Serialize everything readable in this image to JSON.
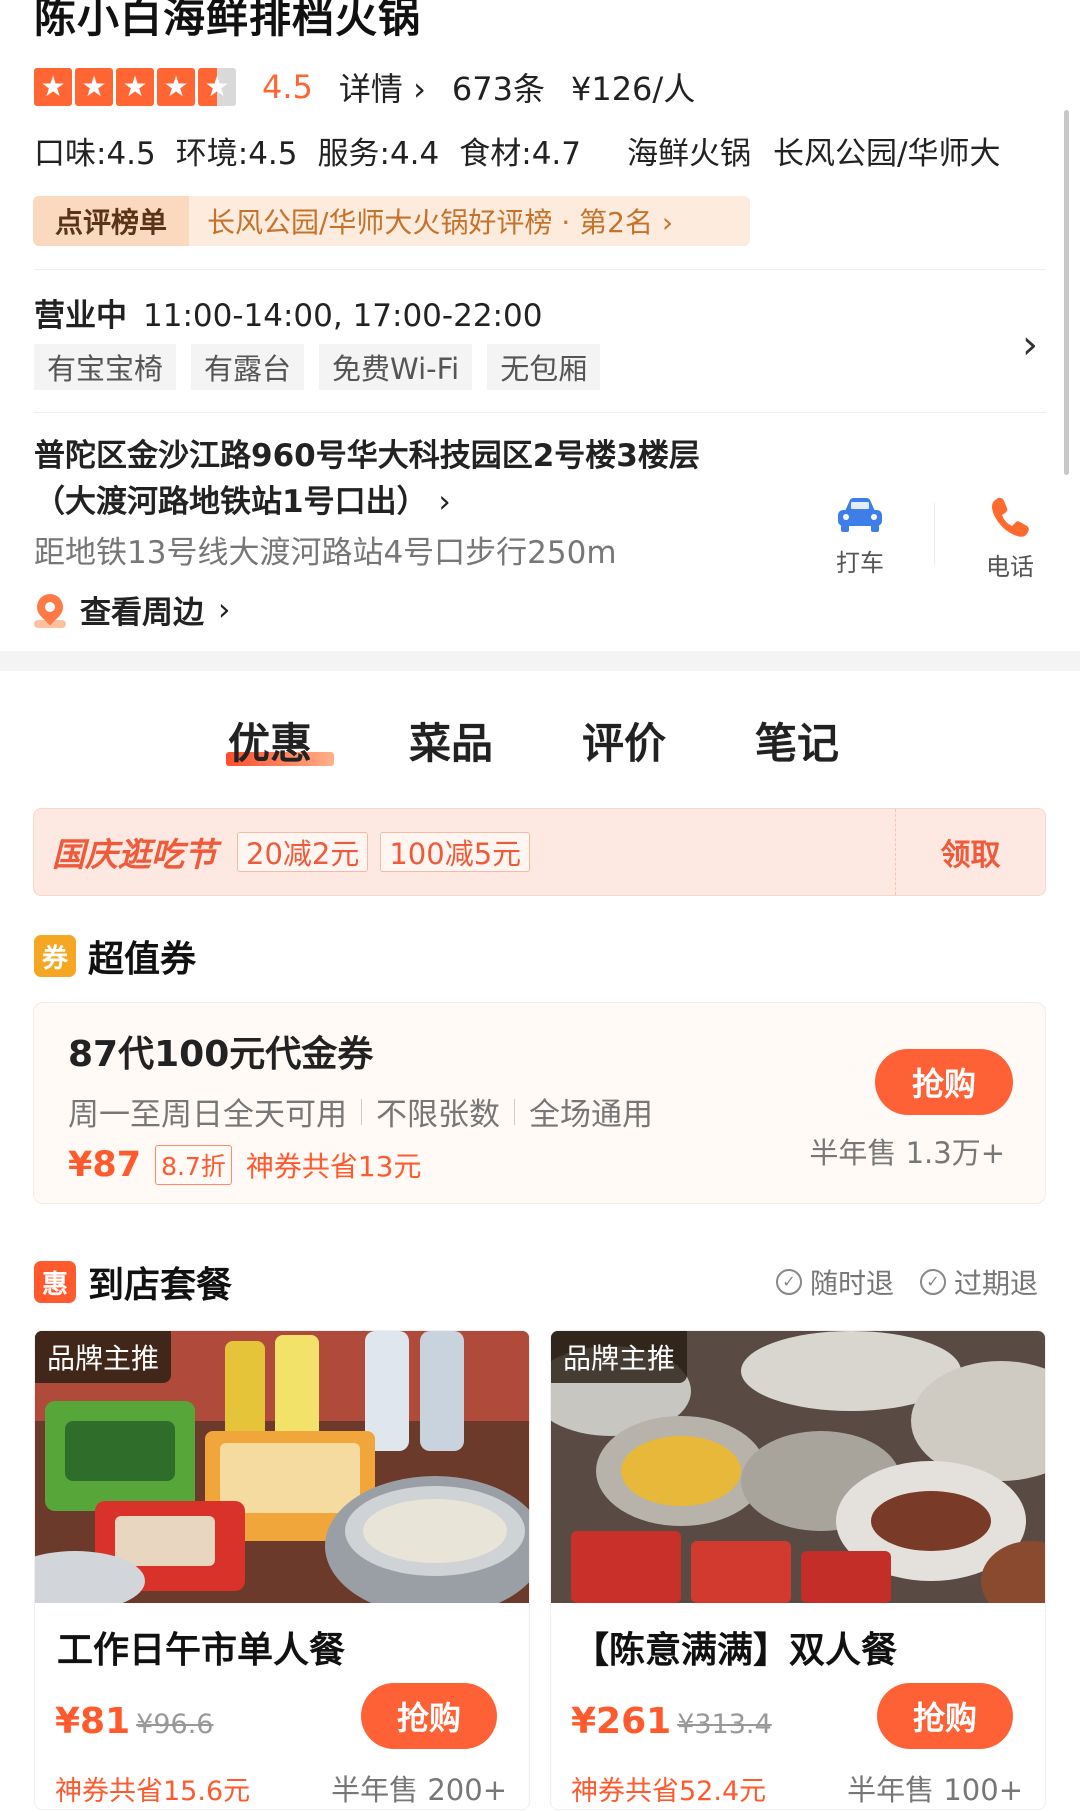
{
  "shop": {
    "name": "陈小白海鲜排档火锅",
    "rating": "4.5",
    "rating_stars": 4.5,
    "details_label": "详情",
    "review_count": "673条",
    "price_per_person": "¥126/人",
    "scores": {
      "taste": "口味:4.5",
      "environment": "环境:4.5",
      "service": "服务:4.4",
      "ingredients": "食材:4.7"
    },
    "category": "海鲜火锅",
    "area": "长风公园/华师大"
  },
  "ranking": {
    "label": "点评榜单",
    "text": "长风公园/华师大火锅好评榜 · 第2名"
  },
  "hours": {
    "status": "营业中",
    "time": "11:00-14:00, 17:00-22:00",
    "facilities": [
      "有宝宝椅",
      "有露台",
      "免费Wi-Fi",
      "无包厢"
    ]
  },
  "address": {
    "line1": "普陀区金沙江路960号华大科技园区2号楼3楼层",
    "line2": "（大渡河路地铁站1号口出）",
    "metro": "距地铁13号线大渡河路站4号口步行250m",
    "nearby_label": "查看周边",
    "taxi_label": "打车",
    "phone_label": "电话"
  },
  "tabs": [
    "优惠",
    "菜品",
    "评价",
    "笔记"
  ],
  "promo": {
    "title": "国庆逛吃节",
    "chips": [
      "20减2元",
      "100减5元"
    ],
    "claim_label": "领取"
  },
  "voucher_section": {
    "icon_char": "券",
    "title": "超值券",
    "icon_color": "#f5a623"
  },
  "coupon": {
    "title": "87代100元代金券",
    "desc": [
      "周一至周日全天可用",
      "不限张数",
      "全场通用"
    ],
    "price": "¥87",
    "discount": "8.7折",
    "saving": "神券共省13元",
    "buy_label": "抢购",
    "sold": "半年售 1.3万+"
  },
  "package_section": {
    "icon_char": "惠",
    "title": "到店套餐",
    "icon_color": "#ff5a2e",
    "refund_anytime": "随时退",
    "refund_expired": "过期退"
  },
  "packages": [
    {
      "badge": "品牌主推",
      "name": "工作日午市单人餐",
      "price": "¥81",
      "original": "¥96.6",
      "saving": "神券共省15.6元",
      "buy_label": "抢购",
      "sold": "半年售 200+"
    },
    {
      "badge": "品牌主推",
      "name": "【陈意满满】双人餐",
      "price": "¥261",
      "original": "¥313.4",
      "saving": "神券共省52.4元",
      "buy_label": "抢购",
      "sold": "半年售 100+"
    }
  ],
  "colors": {
    "accent": "#ff6136",
    "taxi_icon": "#3d7ee8",
    "phone_icon": "#ff6a2e"
  }
}
